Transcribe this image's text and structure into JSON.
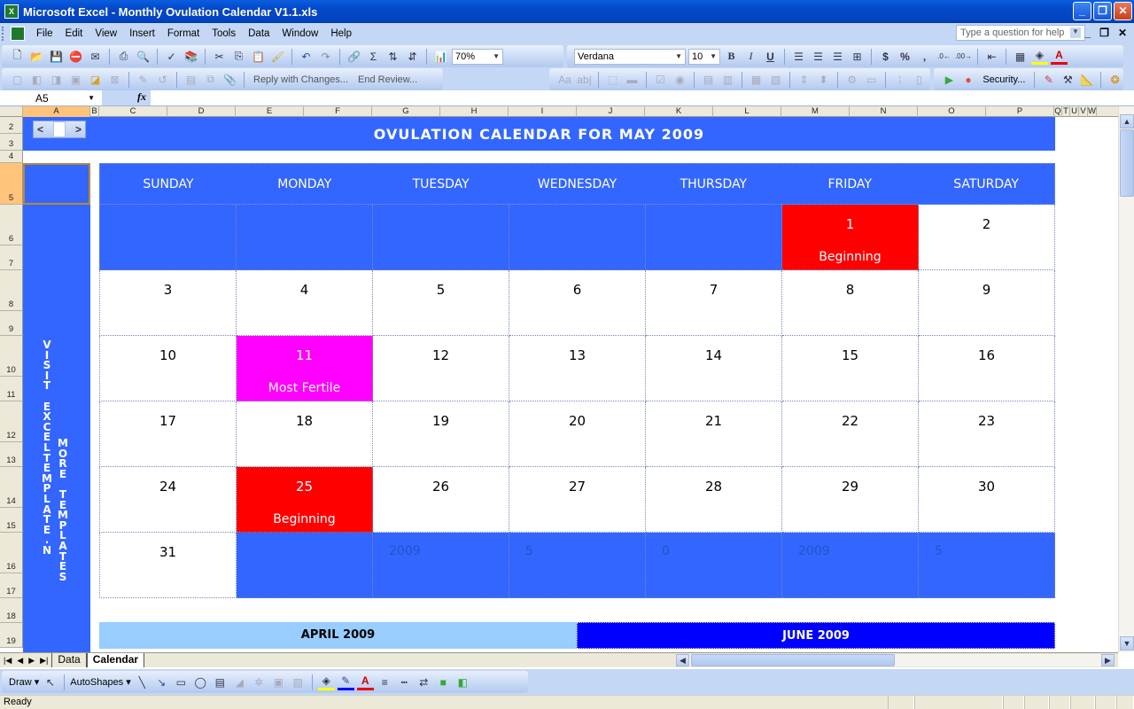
{
  "window": {
    "title": "Microsoft Excel - Monthly Ovulation Calendar V1.1.xls",
    "controls": {
      "minimize": "_",
      "restore": "❐",
      "close": "✕"
    }
  },
  "menu": {
    "items": [
      "File",
      "Edit",
      "View",
      "Insert",
      "Format",
      "Tools",
      "Data",
      "Window",
      "Help"
    ],
    "help_placeholder": "Type a question for help",
    "doc_controls": {
      "minimize": "_",
      "restore": "❐",
      "close": "✕"
    }
  },
  "toolbar": {
    "zoom": "70%",
    "font": "Verdana",
    "font_size": "10",
    "bold": "B",
    "italic": "I",
    "underline": "U",
    "currency": "$",
    "percent": "%",
    "comma": ",",
    "sum": "Σ",
    "reply_with_changes": "Reply with Changes...",
    "end_review": "End Review...",
    "security": "Security..."
  },
  "formula_bar": {
    "name_box": "A5",
    "fx_label": "fx",
    "formula": ""
  },
  "columns": [
    {
      "label": "A",
      "w": 76,
      "selected": true
    },
    {
      "label": "B",
      "w": 10
    },
    {
      "label": "C",
      "w": 77
    },
    {
      "label": "D",
      "w": 77
    },
    {
      "label": "E",
      "w": 77
    },
    {
      "label": "F",
      "w": 77
    },
    {
      "label": "G",
      "w": 77
    },
    {
      "label": "H",
      "w": 77
    },
    {
      "label": "I",
      "w": 77
    },
    {
      "label": "J",
      "w": 77
    },
    {
      "label": "K",
      "w": 77
    },
    {
      "label": "L",
      "w": 77
    },
    {
      "label": "M",
      "w": 77
    },
    {
      "label": "N",
      "w": 77
    },
    {
      "label": "O",
      "w": 77
    },
    {
      "label": "P",
      "w": 77
    },
    {
      "label": "Q",
      "w": 9
    },
    {
      "label": "T",
      "w": 9
    },
    {
      "label": "U",
      "w": 10
    },
    {
      "label": "V",
      "w": 10
    },
    {
      "label": "W",
      "w": 10
    }
  ],
  "rows": [
    {
      "label": "2",
      "h": 19
    },
    {
      "label": "3",
      "h": 19
    },
    {
      "label": "4",
      "h": 14
    },
    {
      "label": "5",
      "h": 47,
      "selected": true
    },
    {
      "label": "6",
      "h": 46
    },
    {
      "label": "7",
      "h": 28
    },
    {
      "label": "8",
      "h": 46
    },
    {
      "label": "9",
      "h": 28
    },
    {
      "label": "10",
      "h": 46
    },
    {
      "label": "11",
      "h": 28
    },
    {
      "label": "12",
      "h": 46
    },
    {
      "label": "13",
      "h": 28
    },
    {
      "label": "14",
      "h": 46
    },
    {
      "label": "15",
      "h": 28
    },
    {
      "label": "16",
      "h": 46
    },
    {
      "label": "17",
      "h": 28
    },
    {
      "label": "18",
      "h": 28
    },
    {
      "label": "19",
      "h": 28
    }
  ],
  "calendar": {
    "title": "OVULATION CALENDAR FOR MAY 2009",
    "spinner": {
      "prev": "<",
      "next": ">"
    },
    "side_text_1": "VISIT EXCELTEMPLATE.N",
    "side_text_2": "MORE TEMPLATES",
    "weekdays": [
      "SUNDAY",
      "MONDAY",
      "TUESDAY",
      "WEDNESDAY",
      "THURSDAY",
      "FRIDAY",
      "SATURDAY"
    ],
    "weeks": [
      [
        {
          "type": "empty"
        },
        {
          "type": "empty"
        },
        {
          "type": "empty"
        },
        {
          "type": "empty"
        },
        {
          "type": "empty"
        },
        {
          "num": "1",
          "type": "beginning",
          "label": "Beginning"
        },
        {
          "num": "2"
        }
      ],
      [
        {
          "num": "3"
        },
        {
          "num": "4"
        },
        {
          "num": "5"
        },
        {
          "num": "6"
        },
        {
          "num": "7"
        },
        {
          "num": "8"
        },
        {
          "num": "9"
        }
      ],
      [
        {
          "num": "10"
        },
        {
          "num": "11",
          "type": "fertile",
          "label": "Most Fertile"
        },
        {
          "num": "12"
        },
        {
          "num": "13"
        },
        {
          "num": "14"
        },
        {
          "num": "15"
        },
        {
          "num": "16"
        }
      ],
      [
        {
          "num": "17"
        },
        {
          "num": "18"
        },
        {
          "num": "19"
        },
        {
          "num": "20"
        },
        {
          "num": "21"
        },
        {
          "num": "22"
        },
        {
          "num": "23"
        }
      ],
      [
        {
          "num": "24"
        },
        {
          "num": "25",
          "type": "beginning",
          "label": "Beginning"
        },
        {
          "num": "26"
        },
        {
          "num": "27"
        },
        {
          "num": "28"
        },
        {
          "num": "29"
        },
        {
          "num": "30"
        }
      ],
      [
        {
          "num": "31"
        },
        {
          "type": "empty"
        },
        {
          "type": "empty",
          "ghost": "2009"
        },
        {
          "type": "empty",
          "ghost": "5"
        },
        {
          "type": "empty",
          "ghost": "0"
        },
        {
          "type": "empty",
          "ghost": "2009"
        },
        {
          "type": "empty",
          "ghost": "5"
        }
      ]
    ],
    "prev_month": "APRIL 2009",
    "next_month": "JUNE 2009",
    "colors": {
      "header_blue": "#3366ff",
      "beginning": "#ff0000",
      "most_fertile": "#ff00ff",
      "prev_month_bg": "#99ccff",
      "next_month_bg": "#0000ff"
    }
  },
  "sheet_tabs": {
    "nav": [
      "|◀",
      "◀",
      "▶",
      "▶|"
    ],
    "tabs": [
      {
        "label": "Data",
        "active": false
      },
      {
        "label": "Calendar",
        "active": true
      }
    ]
  },
  "draw_toolbar": {
    "draw": "Draw ▾",
    "autoshapes": "AutoShapes ▾"
  },
  "status": {
    "text": "Ready"
  }
}
